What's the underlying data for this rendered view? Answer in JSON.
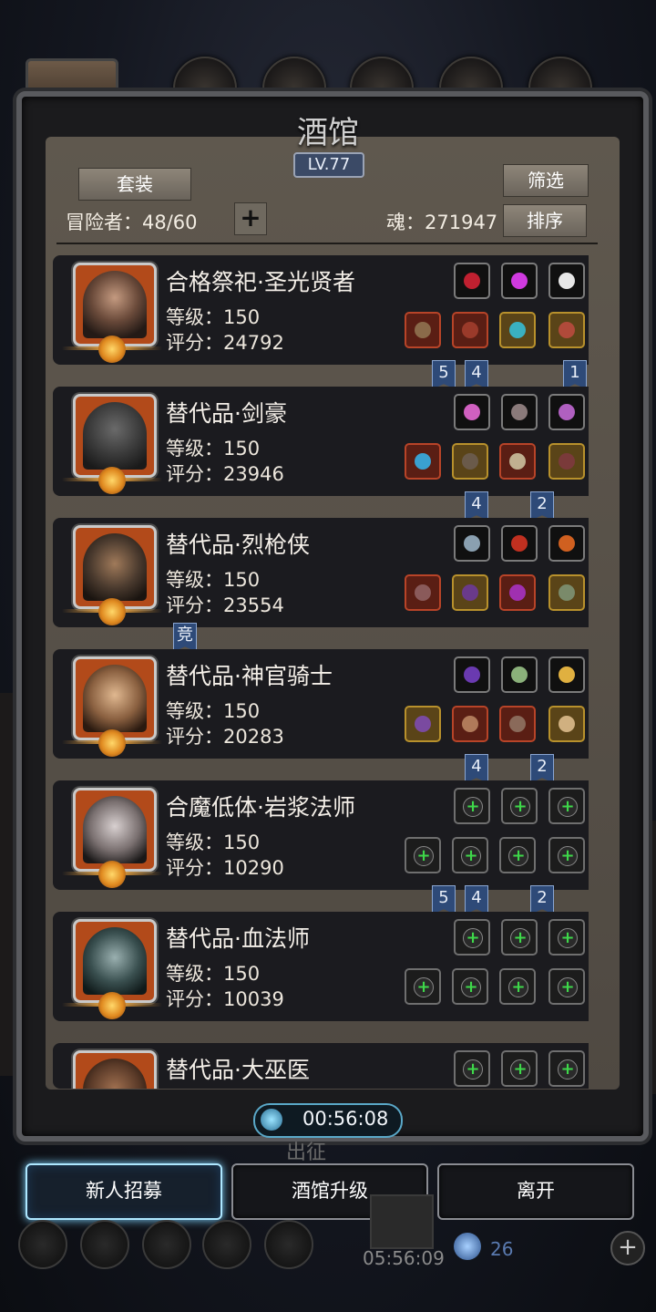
{
  "header": {
    "title": "酒馆",
    "level": "LV.77",
    "set_button": "套装",
    "filter_button": "筛选",
    "sort_button": "排序",
    "adventurers": "冒险者：48/60",
    "add_symbol": "+",
    "soul": "魂：271947"
  },
  "heroes": [
    {
      "name": "合格祭祀·圣光贤者",
      "level": "等级：150",
      "score": "评分：24792"
    },
    {
      "name": "替代品·剑豪",
      "level": "等级：150",
      "score": "评分：23946"
    },
    {
      "name": "替代品·烈枪侠",
      "level": "等级：150",
      "score": "评分：23554"
    },
    {
      "name": "替代品·神官骑士",
      "level": "等级：150",
      "score": "评分：20283"
    },
    {
      "name": "合魔低体·岩浆法师",
      "level": "等级：150",
      "score": "评分：10290"
    },
    {
      "name": "替代品·血法师",
      "level": "等级：150",
      "score": "评分：10039"
    },
    {
      "name": "替代品·大巫医",
      "level": "",
      "score": ""
    }
  ],
  "badges": {
    "b1": "5",
    "b2": "4",
    "b3": "1",
    "b4": "4",
    "b5": "2",
    "b6": "竞",
    "b7": "4",
    "b8": "2",
    "b9": "5",
    "b10": "4",
    "b11": "2"
  },
  "plus_glyph": "+",
  "timer": "00:56:08",
  "expedition_label": "出征",
  "buttons": {
    "recruit": "新人招募",
    "upgrade": "酒馆升级",
    "leave": "离开"
  },
  "bottom": {
    "timer2": "05:56:09",
    "count": "26",
    "plus": "+"
  },
  "colors": {
    "accent_blue": "#7fd4ff",
    "badge_blue": "#2e4a78",
    "gold": "#b8912c",
    "green_plus": "#3ed84a"
  }
}
